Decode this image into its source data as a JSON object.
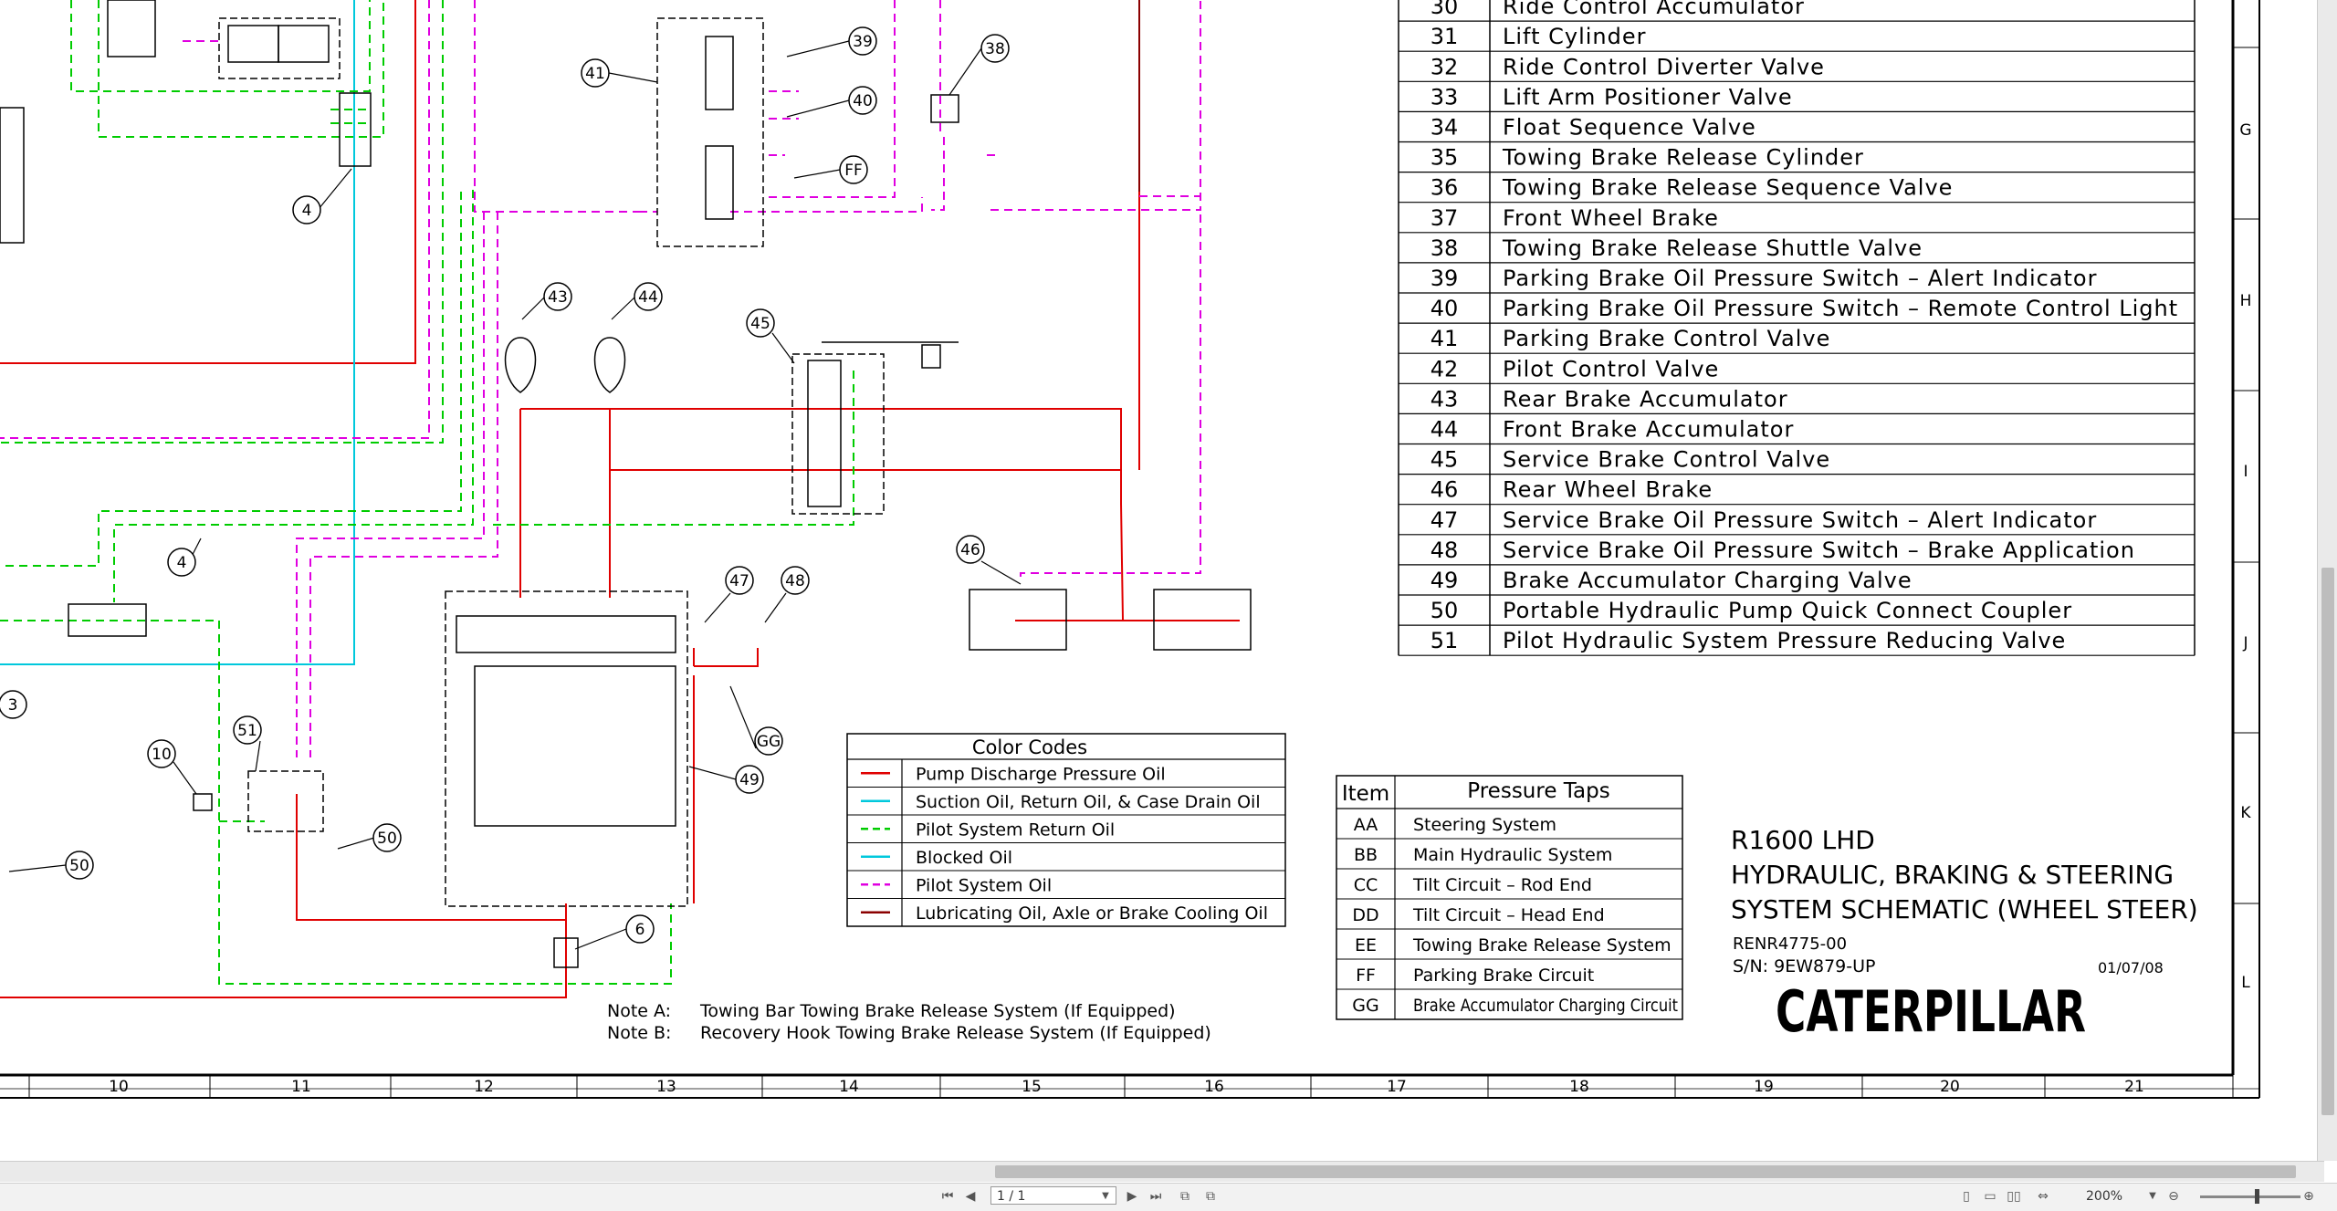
{
  "parts_table": {
    "rows": [
      {
        "num": "30",
        "desc": "Ride Control Accumulator"
      },
      {
        "num": "31",
        "desc": "Lift Cylinder"
      },
      {
        "num": "32",
        "desc": "Ride Control Diverter Valve"
      },
      {
        "num": "33",
        "desc": "Lift Arm Positioner Valve"
      },
      {
        "num": "34",
        "desc": "Float Sequence Valve"
      },
      {
        "num": "35",
        "desc": "Towing Brake Release Cylinder"
      },
      {
        "num": "36",
        "desc": "Towing Brake Release Sequence Valve"
      },
      {
        "num": "37",
        "desc": "Front Wheel Brake"
      },
      {
        "num": "38",
        "desc": "Towing Brake Release Shuttle Valve"
      },
      {
        "num": "39",
        "desc": "Parking Brake Oil Pressure Switch – Alert Indicator"
      },
      {
        "num": "40",
        "desc": "Parking Brake Oil Pressure Switch – Remote Control Light"
      },
      {
        "num": "41",
        "desc": "Parking Brake Control Valve"
      },
      {
        "num": "42",
        "desc": "Pilot Control Valve"
      },
      {
        "num": "43",
        "desc": "Rear Brake Accumulator"
      },
      {
        "num": "44",
        "desc": "Front Brake Accumulator"
      },
      {
        "num": "45",
        "desc": "Service Brake Control Valve"
      },
      {
        "num": "46",
        "desc": "Rear Wheel Brake"
      },
      {
        "num": "47",
        "desc": "Service Brake Oil Pressure Switch – Alert Indicator"
      },
      {
        "num": "48",
        "desc": "Service Brake Oil Pressure Switch – Brake Application"
      },
      {
        "num": "49",
        "desc": "Brake Accumulator Charging Valve"
      },
      {
        "num": "50",
        "desc": "Portable Hydraulic Pump Quick Connect Coupler"
      },
      {
        "num": "51",
        "desc": "Pilot Hydraulic System Pressure Reducing Valve"
      }
    ]
  },
  "color_codes": {
    "title": "Color Codes",
    "entries": [
      {
        "label": "Pump Discharge Pressure Oil",
        "color": "#e00000",
        "dashed": false
      },
      {
        "label": "Suction Oil, Return Oil, & Case Drain Oil",
        "color": "#00c8dc",
        "dashed": false
      },
      {
        "label": "Pilot System Return Oil",
        "color": "#00cc00",
        "dashed": true
      },
      {
        "label": "Blocked Oil",
        "color": "#00c8dc",
        "dashed": false
      },
      {
        "label": "Pilot System Oil",
        "color": "#e000e0",
        "dashed": true
      },
      {
        "label": "Lubricating Oil, Axle or Brake Cooling Oil",
        "color": "#8b0000",
        "dashed": false
      }
    ]
  },
  "pressure_taps": {
    "col_item": "Item",
    "col_desc": "Pressure Taps",
    "rows": [
      {
        "item": "AA",
        "desc": "Steering System"
      },
      {
        "item": "BB",
        "desc": "Main Hydraulic System"
      },
      {
        "item": "CC",
        "desc": "Tilt Circuit – Rod End"
      },
      {
        "item": "DD",
        "desc": "Tilt Circuit – Head End"
      },
      {
        "item": "EE",
        "desc": "Towing Brake Release System"
      },
      {
        "item": "FF",
        "desc": "Parking Brake Circuit"
      },
      {
        "item": "GG",
        "desc": "Brake Accumulator Charging Circuit"
      }
    ]
  },
  "title_block": {
    "line1": "R1600 LHD",
    "line2": "HYDRAULIC, BRAKING & STEERING",
    "line3": "SYSTEM SCHEMATIC (WHEEL STEER)",
    "doc_number": "RENR4775-00",
    "serial": "S/N: 9EW879-UP",
    "date": "01/07/08",
    "logo": "CATERPILLAR"
  },
  "notes": {
    "a_label": "Note A:",
    "a_text": "Towing Bar Towing Brake Release System (If Equipped)",
    "b_label": "Note B:",
    "b_text": "Recovery Hook Towing Brake Release System (If Equipped)"
  },
  "border": {
    "columns": [
      "10",
      "11",
      "12",
      "13",
      "14",
      "15",
      "16",
      "17",
      "18",
      "19",
      "20",
      "21"
    ],
    "rows": [
      "G",
      "H",
      "I",
      "J",
      "K",
      "L"
    ]
  },
  "callouts": [
    "3",
    "4",
    "4",
    "6",
    "10",
    "38",
    "39",
    "40",
    "41",
    "43",
    "44",
    "45",
    "46",
    "47",
    "48",
    "49",
    "50",
    "50",
    "51",
    "FF",
    "GG"
  ],
  "viewer": {
    "page_field": "1 / 1",
    "zoom": "200%"
  },
  "colors": {
    "pressure": "#e00000",
    "suction": "#00c8dc",
    "pilot_return": "#00cc00",
    "pilot": "#e000e0",
    "lube": "#8b0000"
  }
}
